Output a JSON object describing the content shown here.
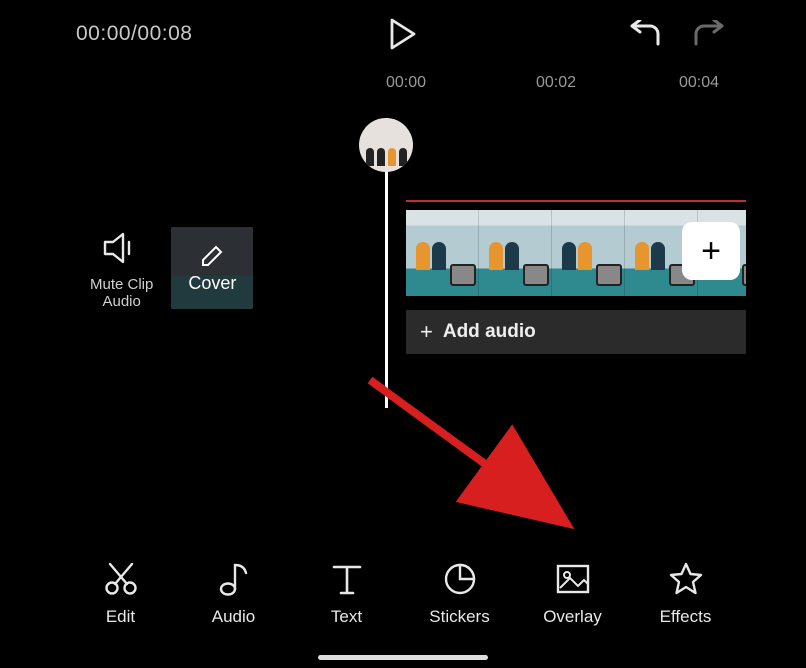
{
  "topbar": {
    "timecode": "00:00/00:08"
  },
  "ruler": {
    "marks": [
      "00:00",
      "00:02",
      "00:04"
    ]
  },
  "side": {
    "mute_label_line1": "Mute Clip",
    "mute_label_line2": "Audio",
    "cover_label": "Cover"
  },
  "audio_row": {
    "label": "Add audio"
  },
  "toolbar": {
    "items": [
      {
        "label": "Edit"
      },
      {
        "label": "Audio"
      },
      {
        "label": "Text"
      },
      {
        "label": "Stickers"
      },
      {
        "label": "Overlay"
      },
      {
        "label": "Effects"
      }
    ]
  },
  "plus": "+",
  "audio_plus": "+"
}
